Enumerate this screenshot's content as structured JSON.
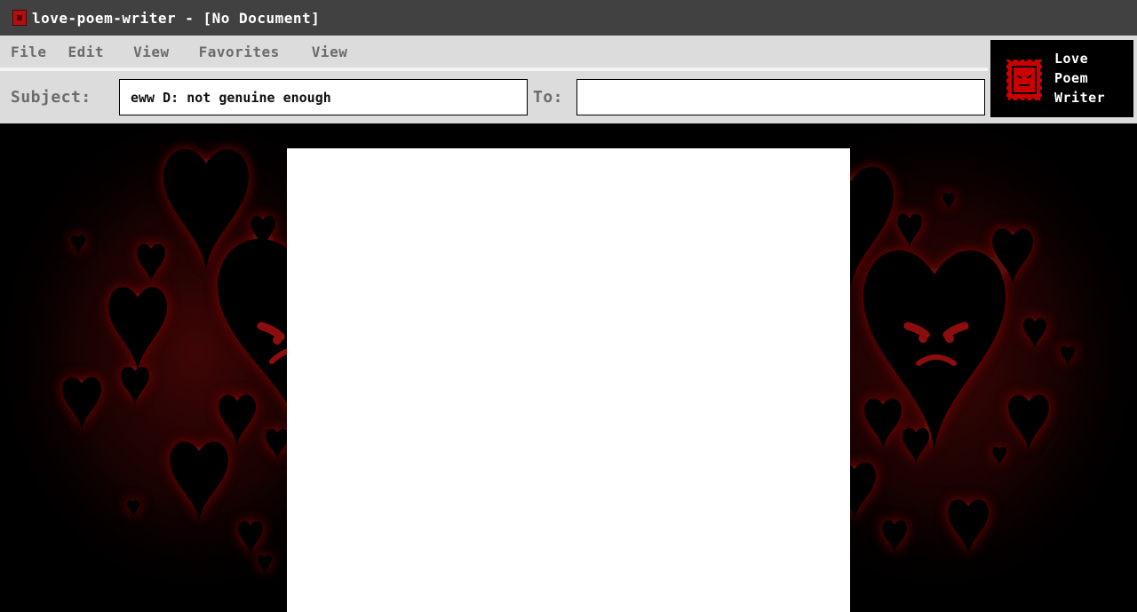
{
  "window": {
    "title": "love-poem-writer - [No Document]",
    "icon": "app-stamp-icon"
  },
  "menu": {
    "items": [
      "File",
      "Edit",
      "View",
      "Favorites",
      "View"
    ]
  },
  "subject": {
    "label": "Subject:",
    "value": "eww D: not genuine enough"
  },
  "to": {
    "label": "To:",
    "value": ""
  },
  "logo": {
    "line1": "Love",
    "line2": "Poem",
    "line3": "Writer",
    "icon": "angry-stamp-icon"
  },
  "document": {
    "content": ""
  },
  "colors": {
    "accent": "#b01010",
    "glow": "#7a0a0a",
    "titlebar": "#414141",
    "toolbar": "#dcdcdc"
  }
}
